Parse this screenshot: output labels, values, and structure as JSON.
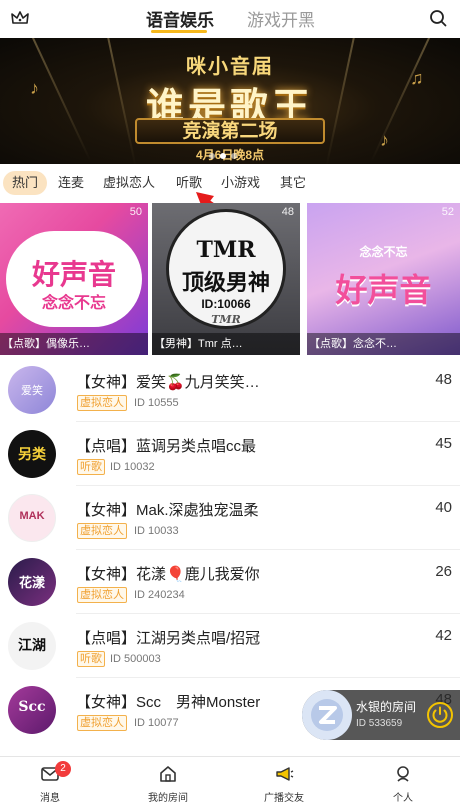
{
  "header": {
    "tabs": [
      {
        "label": "语音娱乐",
        "active": true
      },
      {
        "label": "游戏开黑",
        "active": false
      }
    ],
    "icons": {
      "left": "crown-icon",
      "right": "search-icon"
    }
  },
  "banner": {
    "top_line": "咪小音届",
    "title": "谁是歌王",
    "subtitle": "竞演第二场",
    "date": "4月6日晚8点"
  },
  "categories": [
    "热门",
    "连麦",
    "虚拟恋人",
    "听歌",
    "小游戏",
    "其它"
  ],
  "featured": [
    {
      "caption": "【点歌】偶像乐…",
      "count": "50",
      "art_text_1": "好声音",
      "art_text_2": "念念不忘"
    },
    {
      "caption": "【男神】Tmr 点…",
      "count": "48",
      "art_text_1": "TMR",
      "art_text_2": "顶级男神",
      "art_text_3": "ID:10066",
      "art_text_4": "TMR"
    },
    {
      "caption": "【点歌】念念不…",
      "count": "52",
      "art_text_1": "好声音",
      "art_text_2": "念念不忘"
    }
  ],
  "rooms": [
    {
      "title": "【女神】爱笑🍒九月笑笑…",
      "tag": "虚拟恋人",
      "id": "ID 10555",
      "count": "48",
      "avatar_text": "爱笑"
    },
    {
      "title": "【点唱】蓝调另类点唱cc最",
      "tag": "听歌",
      "id": "ID 10032",
      "count": "45",
      "avatar_text": "另类"
    },
    {
      "title": "【女神】Mak.深處独宠温柔",
      "tag": "虚拟恋人",
      "id": "ID 10033",
      "count": "40",
      "avatar_text": "MAK"
    },
    {
      "title": "【女神】花漾🎈鹿儿我爱你",
      "tag": "虚拟恋人",
      "id": "ID 240234",
      "count": "26",
      "avatar_text": "花漾"
    },
    {
      "title": "【点唱】江湖另类点唱/招冠",
      "tag": "听歌",
      "id": "ID 500003",
      "count": "42",
      "avatar_text": "江湖"
    },
    {
      "title": "【女神】Scc　男神Monster",
      "tag": "虚拟恋人",
      "id": "ID 10077",
      "count": "48",
      "avatar_text": "Scc"
    }
  ],
  "floating_room": {
    "name": "水银的房间",
    "id": "ID 533659"
  },
  "nav": [
    {
      "label": "消息",
      "icon": "message-icon",
      "badge": "2"
    },
    {
      "label": "我的房间",
      "icon": "home-icon"
    },
    {
      "label": "广播交友",
      "icon": "megaphone-icon"
    },
    {
      "label": "个人",
      "icon": "person-icon"
    }
  ],
  "colors": {
    "accent": "#f6b81c",
    "tag_border": "#f3b14c",
    "tag_text": "#f0a132",
    "chip_active_bg": "#fbe3c1",
    "badge": "#f23b3b"
  }
}
